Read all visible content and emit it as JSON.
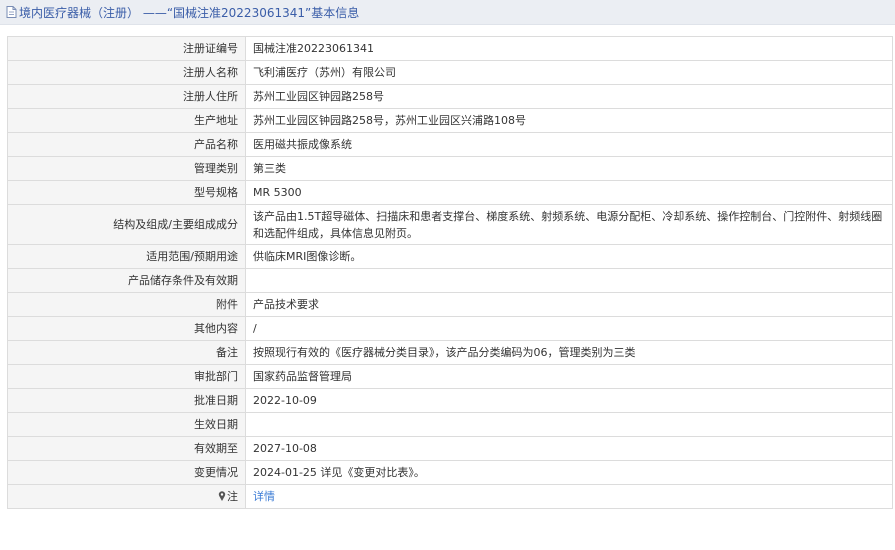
{
  "header": {
    "title": "境内医疗器械（注册） ——“国械注准20223061341”基本信息"
  },
  "rows": [
    {
      "label": "注册证编号",
      "value": "国械注准20223061341"
    },
    {
      "label": "注册人名称",
      "value": "飞利浦医疗（苏州）有限公司"
    },
    {
      "label": "注册人住所",
      "value": "苏州工业园区钟园路258号"
    },
    {
      "label": "生产地址",
      "value": "苏州工业园区钟园路258号，苏州工业园区兴浦路108号"
    },
    {
      "label": "产品名称",
      "value": "医用磁共振成像系统"
    },
    {
      "label": "管理类别",
      "value": "第三类"
    },
    {
      "label": "型号规格",
      "value": "MR 5300"
    },
    {
      "label": "结构及组成/主要组成成分",
      "value": "该产品由1.5T超导磁体、扫描床和患者支撑台、梯度系统、射频系统、电源分配柜、冷却系统、操作控制台、门控附件、射频线圈和选配件组成，具体信息见附页。"
    },
    {
      "label": "适用范围/预期用途",
      "value": "供临床MRI图像诊断。"
    },
    {
      "label": "产品储存条件及有效期",
      "value": ""
    },
    {
      "label": "附件",
      "value": "产品技术要求"
    },
    {
      "label": "其他内容",
      "value": "/"
    },
    {
      "label": "备注",
      "value": "按照现行有效的《医疗器械分类目录》，该产品分类编码为06，管理类别为三类"
    },
    {
      "label": "审批部门",
      "value": "国家药品监督管理局"
    },
    {
      "label": "批准日期",
      "value": "2022-10-09"
    },
    {
      "label": "生效日期",
      "value": ""
    },
    {
      "label": "有效期至",
      "value": "2027-10-08"
    },
    {
      "label": "变更情况",
      "value": "2024-01-25 详见《变更对比表》。"
    },
    {
      "label": "注",
      "value": "详情",
      "icon": "pin-icon"
    }
  ]
}
